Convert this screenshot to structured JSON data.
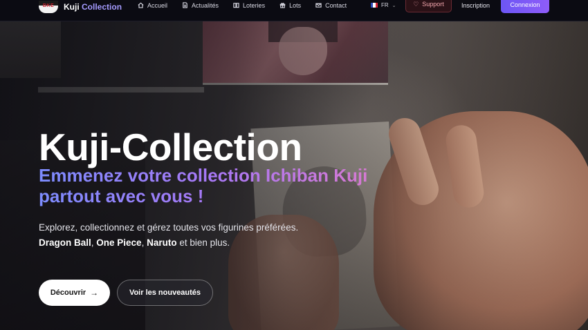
{
  "brand": {
    "name_part1": "Kuji",
    "name_part2": "Collection",
    "badge_text": "BKE",
    "accent_color": "#a59bff"
  },
  "nav": {
    "items": [
      {
        "label": "Accueil",
        "icon": "home-icon"
      },
      {
        "label": "Actualités",
        "icon": "document-icon"
      },
      {
        "label": "Loteries",
        "icon": "book-icon"
      },
      {
        "label": "Lots",
        "icon": "gift-icon"
      },
      {
        "label": "Contact",
        "icon": "mail-icon"
      }
    ],
    "language": "FR",
    "support_label": "Support",
    "inscription_label": "Inscription",
    "connexion_label": "Connexion"
  },
  "hero": {
    "title": "Kuji-Collection",
    "subtitle": "Emmenez votre collection Ichiban Kuji partout avec vous !",
    "description_line1": "Explorez, collectionnez et gérez toutes vos figurines préférées.",
    "franchise1": "Dragon Ball",
    "franchise2": "One Piece",
    "franchise3": "Naruto",
    "description_tail": " et bien plus.",
    "primary_button": "Découvrir",
    "secondary_button": "Voir les nouveautés"
  },
  "colors": {
    "connexion_gradient_start": "#6c56f5",
    "connexion_gradient_end": "#8f5cf8",
    "subtitle_gradient": [
      "#7d8cff",
      "#a878f5",
      "#e77ac6"
    ]
  }
}
